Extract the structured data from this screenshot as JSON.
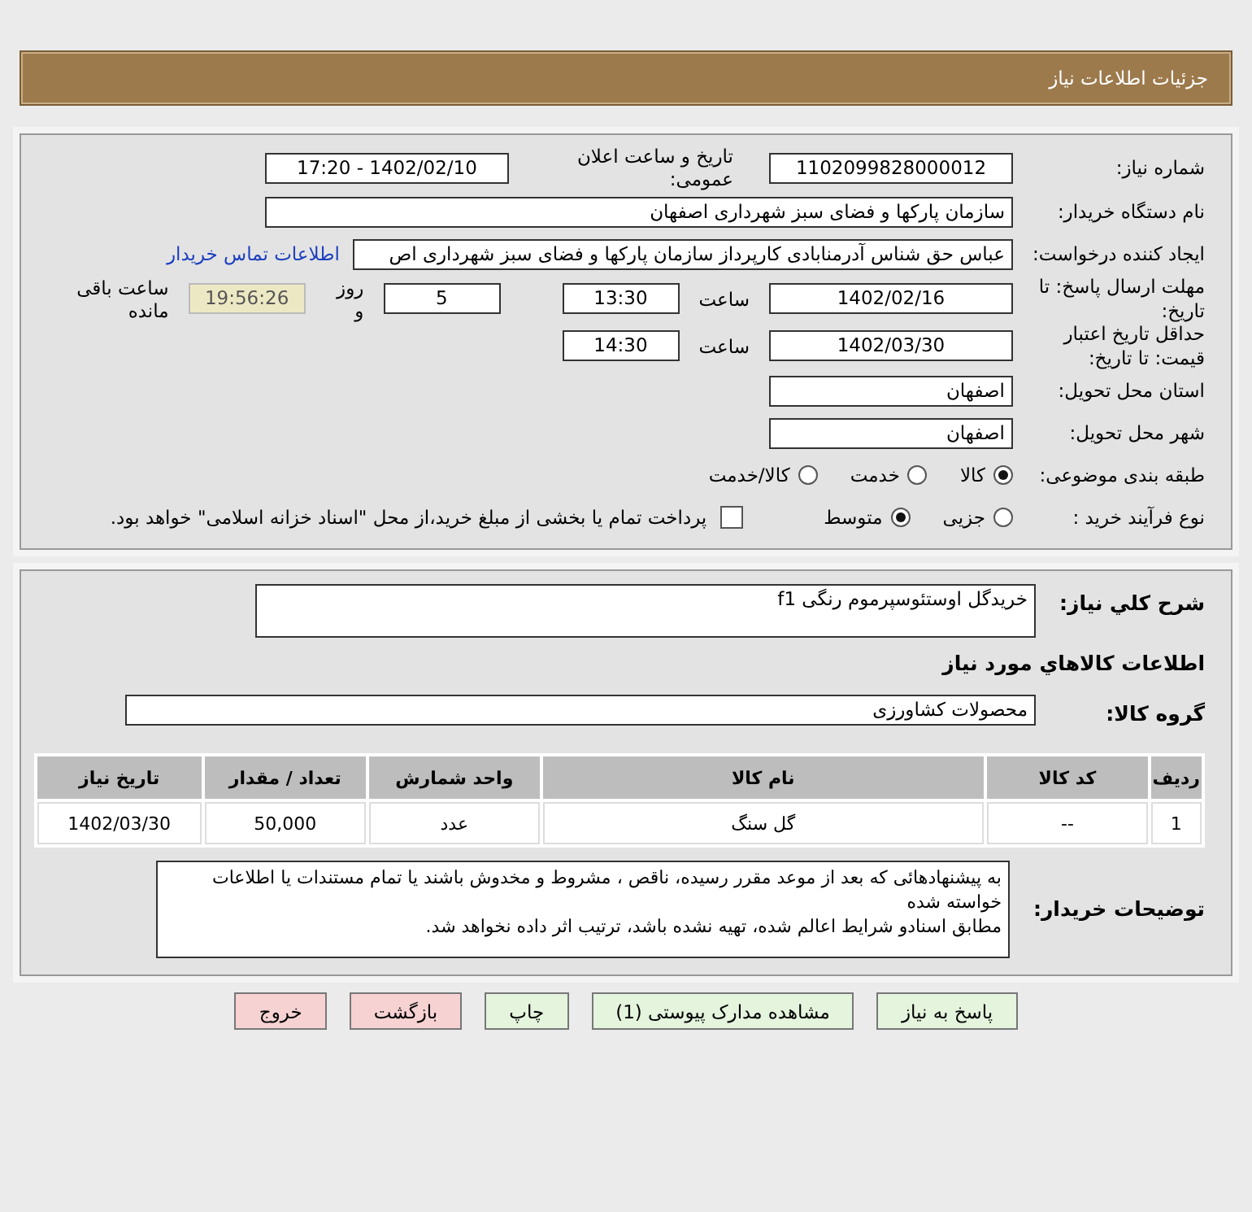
{
  "header": {
    "title": "جزئیات اطلاعات نیاز"
  },
  "need_number": {
    "label": "شماره نیاز:",
    "value": "1102099828000012"
  },
  "announce": {
    "label": "تاریخ و ساعت اعلان عمومی:",
    "value": "1402/02/10 - 17:20"
  },
  "buyer_org": {
    "label": "نام دستگاه خریدار:",
    "value": "سازمان پارکها و فضای سبز شهرداری اصفهان"
  },
  "requester": {
    "label": "ایجاد کننده درخواست:",
    "value": "عباس حق شناس آدرمنابادی کارپرداز سازمان پارکها و فضای سبز شهرداری اص",
    "link": "اطلاعات تماس خریدار"
  },
  "deadline": {
    "label": "مهلت ارسال پاسخ: تا تاریخ:",
    "date": "1402/02/16",
    "time_label": "ساعت",
    "time": "13:30",
    "days": "5",
    "days_label": "روز و",
    "remaining": "19:56:26",
    "remaining_label": "ساعت باقی مانده"
  },
  "validity": {
    "label": "حداقل تاریخ اعتبار قیمت: تا تاریخ:",
    "date": "1402/03/30",
    "time_label": "ساعت",
    "time": "14:30"
  },
  "province": {
    "label": "استان محل تحویل:",
    "value": "اصفهان"
  },
  "city": {
    "label": "شهر محل تحویل:",
    "value": "اصفهان"
  },
  "category": {
    "label": "طبقه بندی موضوعی:",
    "options": [
      {
        "label": "کالا",
        "selected": true
      },
      {
        "label": "خدمت",
        "selected": false
      },
      {
        "label": "کالا/خدمت",
        "selected": false
      }
    ]
  },
  "process": {
    "label": "نوع فرآیند خرید :",
    "options": [
      {
        "label": "جزیی",
        "selected": false
      },
      {
        "label": "متوسط",
        "selected": true
      }
    ],
    "payment": {
      "checked": false,
      "text": "پرداخت تمام یا بخشی از مبلغ خرید،از محل \"اسناد خزانه اسلامی\" خواهد بود."
    }
  },
  "summary": {
    "label": "شرح کلي نیاز:",
    "value": "خریدگل اوستئوسپرموم رنگی f1"
  },
  "goods_title": "اطلاعات كالاهاي مورد نیاز",
  "group": {
    "label": "گروه کالا:",
    "value": "محصولات کشاورزی"
  },
  "table": {
    "columns": [
      "ردیف",
      "کد کالا",
      "نام کالا",
      "واحد شمارش",
      "تعداد / مقدار",
      "تاریخ نیاز"
    ],
    "rows": [
      [
        "1",
        "--",
        "گل سنگ",
        "عدد",
        "50,000",
        "1402/03/30"
      ]
    ]
  },
  "notes": {
    "label": "توضیحات خریدار:",
    "paragraphs": [
      "به پیشنهادهائی که بعد از موعد مقرر رسیده، ناقص ، مشروط و مخدوش باشند یا تمام مستندات یا اطلاعات خواسته شده",
      "مطابق اسنادو شرایط اعالم شده، تهیه نشده باشد، ترتیب اثر داده نخواهد شد."
    ]
  },
  "buttons": [
    {
      "label": "پاسخ به نیاز",
      "kind": "normal"
    },
    {
      "label": "مشاهده مدارک پیوستی (1)",
      "kind": "normal"
    },
    {
      "label": "چاپ",
      "kind": "normal"
    },
    {
      "label": "بازگشت",
      "kind": "warn"
    },
    {
      "label": "خروج",
      "kind": "warn"
    }
  ]
}
